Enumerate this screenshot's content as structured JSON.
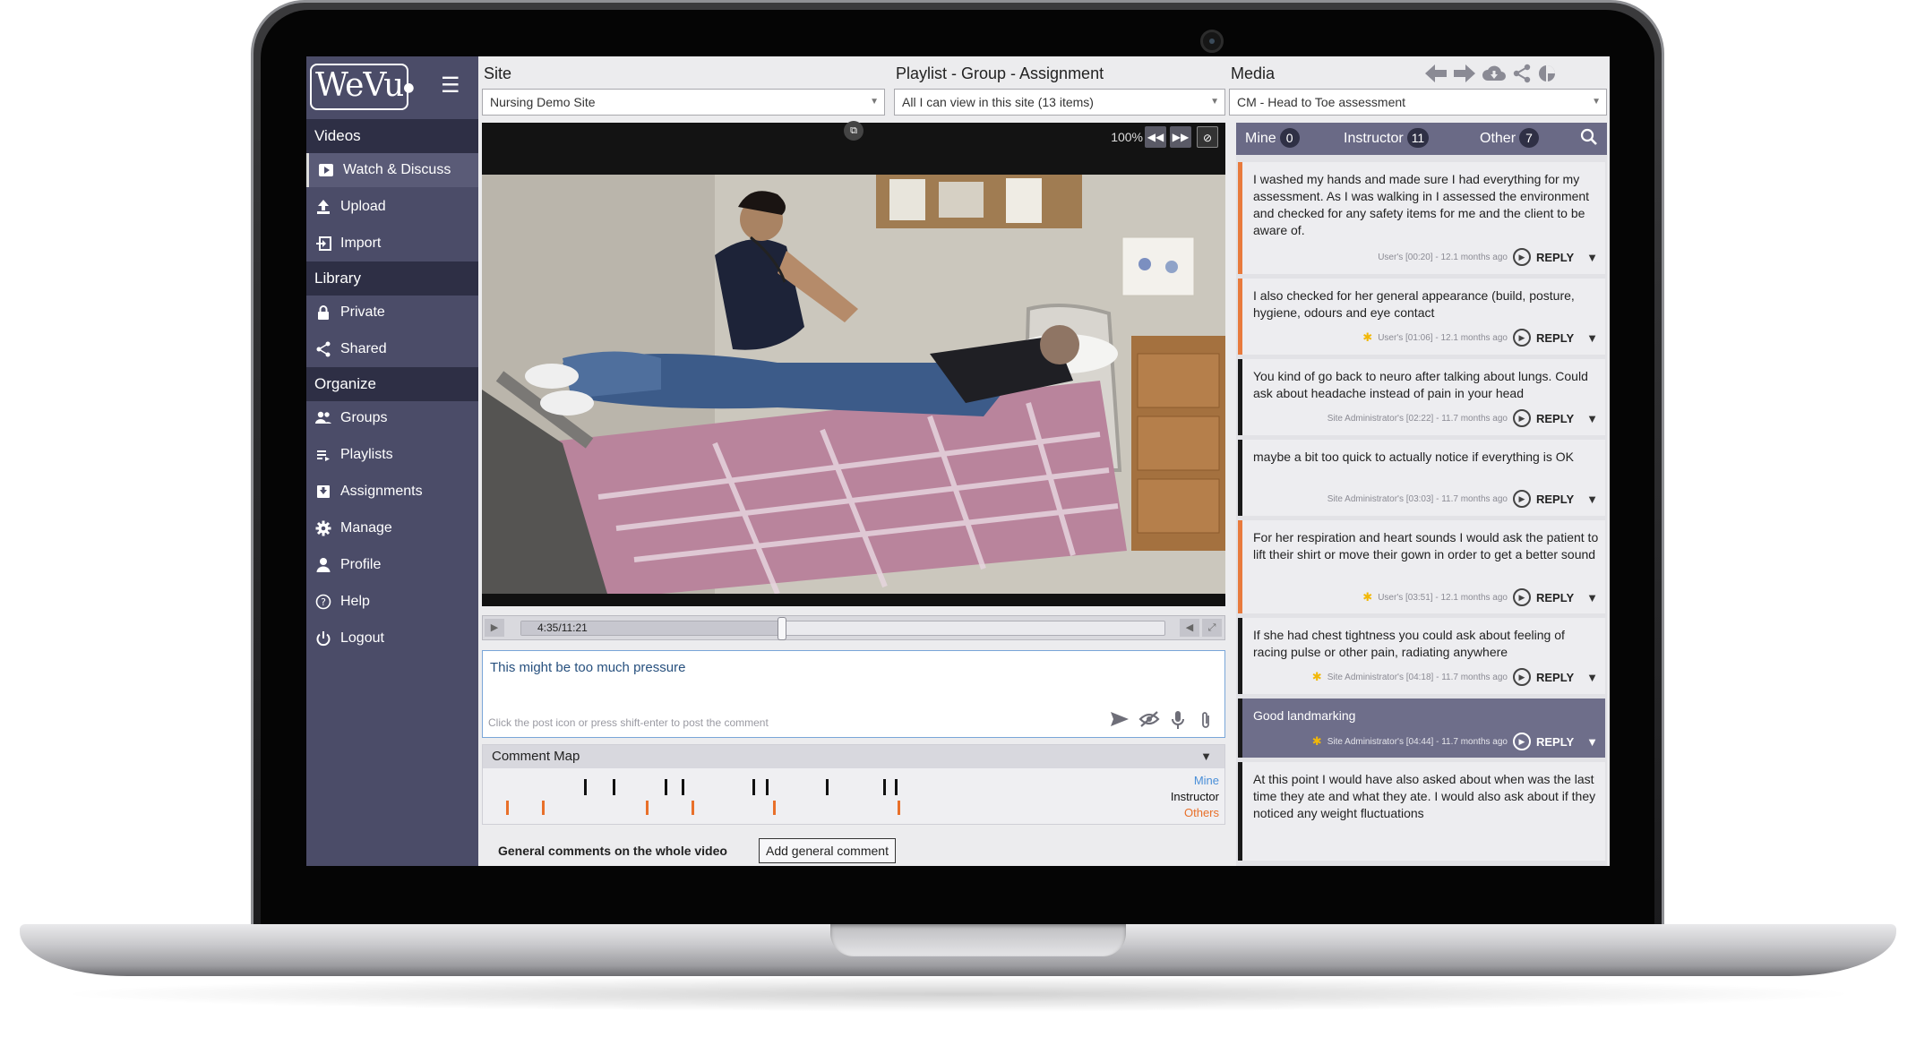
{
  "app": {
    "logo_text": "WeVu",
    "menu_icon": "hamburger-icon"
  },
  "sidebar": {
    "sections": {
      "videos": "Videos",
      "library": "Library",
      "organize": "Organize"
    },
    "items": [
      {
        "label": "Watch & Discuss",
        "icon": "video-icon"
      },
      {
        "label": "Upload",
        "icon": "upload-icon"
      },
      {
        "label": "Import",
        "icon": "import-icon"
      },
      {
        "label": "Private",
        "icon": "lock-icon"
      },
      {
        "label": "Shared",
        "icon": "share-icon"
      },
      {
        "label": "Groups",
        "icon": "groups-icon"
      },
      {
        "label": "Playlists",
        "icon": "playlist-icon"
      },
      {
        "label": "Assignments",
        "icon": "assignment-icon"
      },
      {
        "label": "Manage",
        "icon": "gear-icon"
      },
      {
        "label": "Profile",
        "icon": "user-icon"
      },
      {
        "label": "Help",
        "icon": "help-icon"
      },
      {
        "label": "Logout",
        "icon": "power-icon"
      }
    ]
  },
  "header": {
    "site_label": "Site",
    "site_value": "Nursing Demo Site",
    "playlist_label": "Playlist - Group - Assignment",
    "playlist_value": "All I can view in this site (13 items)",
    "media_label": "Media",
    "media_value": "CM - Head to Toe assessment",
    "tools": [
      "arrow-left-icon",
      "arrow-right-icon",
      "cloud-download-icon",
      "share-icon",
      "pie-chart-icon"
    ]
  },
  "player": {
    "zoom": "100%",
    "timecode": "4:35/11:21",
    "progress": 0.404
  },
  "composer": {
    "text": "This might be too much pressure",
    "hint": "Click the post icon or press shift-enter to post the comment"
  },
  "comment_map": {
    "title": "Comment Map",
    "legend": {
      "mine": "Mine",
      "instructor": "Instructor",
      "others": "Others"
    },
    "colors": {
      "mine": "#4a8fd8",
      "instructor": "#111111",
      "others": "#e8702a"
    },
    "instructor_marks": [
      0.138,
      0.182,
      0.263,
      0.289,
      0.398,
      0.419,
      0.513,
      0.601,
      0.62
    ],
    "other_marks": [
      0.016,
      0.072,
      0.233,
      0.304,
      0.43,
      0.623
    ]
  },
  "general": {
    "label": "General comments on the whole video",
    "button": "Add general comment"
  },
  "comments_panel": {
    "tabs": [
      {
        "label": "Mine",
        "count": "0"
      },
      {
        "label": "Instructor",
        "count": "11"
      },
      {
        "label": "Other",
        "count": "7"
      }
    ],
    "reply_label": "REPLY",
    "items": [
      {
        "text": "I washed my hands and made sure I had everything for my assessment. As I was walking in I assessed the environment and checked for any safety items for me and the client to be aware of.",
        "meta": "User's [00:20] - 12.1 months ago",
        "star": false
      },
      {
        "text": "I also checked for her general appearance  (build, posture, hygiene, odours and eye contact",
        "meta": "User's [01:06] - 12.1 months ago",
        "star": true
      },
      {
        "text": "You kind of go back to neuro after talking about lungs. Could ask about headache instead of pain in your head",
        "meta": "Site Administrator's [02:22] - 11.7 months ago",
        "star": false
      },
      {
        "text": "maybe a bit too quick to actually notice if everything is OK",
        "meta": "Site Administrator's [03:03] - 11.7 months ago",
        "star": false
      },
      {
        "text": "For her respiration and heart sounds I would ask the patient to lift their shirt or move their gown in order to get a better sound",
        "meta": "User's [03:51] - 12.1 months ago",
        "star": true
      },
      {
        "text": "If she had chest tightness you could ask about feeling of racing pulse or other pain, radiating anywhere",
        "meta": "Site Administrator's [04:18] - 11.7 months ago",
        "star": true
      },
      {
        "text": "Good landmarking",
        "meta": "Site Administrator's [04:44] - 11.7 months ago",
        "star": true
      },
      {
        "text": "At this point I would have also asked about when was the last time they ate and what they ate. I would also ask about if they noticed any weight fluctuations",
        "meta": "",
        "star": false
      }
    ]
  }
}
